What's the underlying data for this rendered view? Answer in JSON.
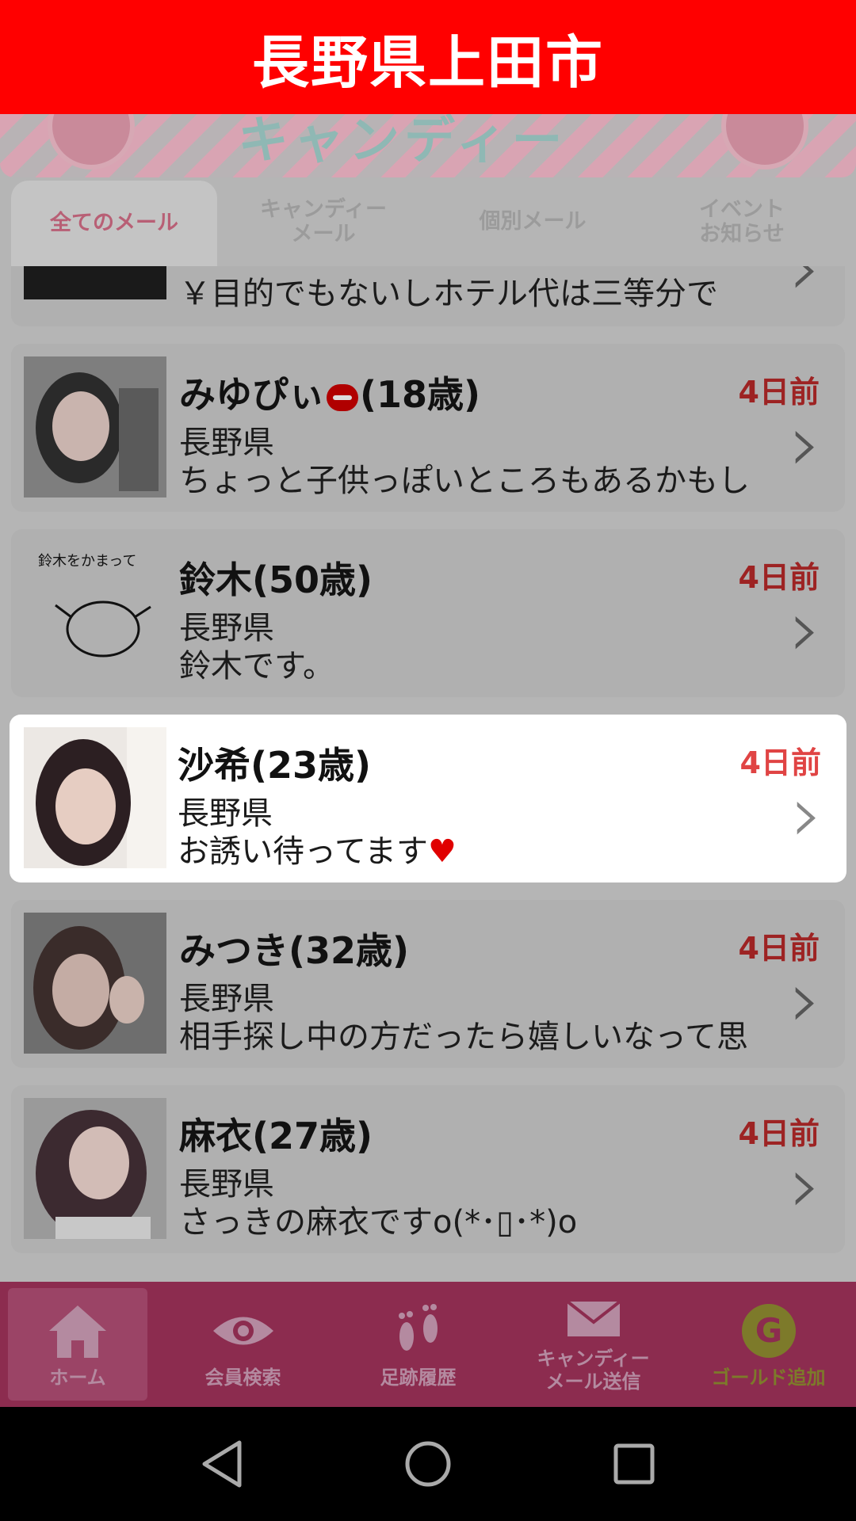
{
  "banner": {
    "title": "長野県上田市"
  },
  "header": {
    "logo_text": "キャンディー"
  },
  "tabs": [
    {
      "label": "全てのメール",
      "active": true
    },
    {
      "label": "キャンディー\nメール",
      "active": false
    },
    {
      "label": "個別メール",
      "active": false
    },
    {
      "label": "イベント\nお知らせ",
      "active": false
    }
  ],
  "messages": {
    "partial": {
      "msg": "￥目的でもないしホテル代は三等分で"
    },
    "items": [
      {
        "name": "みゆぴぃ",
        "age": "(18歳)",
        "time": "4日前",
        "pref": "長野県",
        "msg": "ちょっと子供っぽいところもあるかもし"
      },
      {
        "name": "鈴木(50歳)",
        "time": "4日前",
        "pref": "長野県",
        "msg": "鈴木です。",
        "thumb_text": "鈴木をかまって"
      },
      {
        "name": "沙希(23歳)",
        "time": "4日前",
        "pref": "長野県",
        "msg": "お誘い待ってます",
        "heart": "♥"
      },
      {
        "name": "みつき(32歳)",
        "time": "4日前",
        "pref": "長野県",
        "msg": "相手探し中の方だったら嬉しいなって思"
      },
      {
        "name": "麻衣(27歳)",
        "time": "4日前",
        "pref": "長野県",
        "msg": "さっきの麻衣ですo(*･▯･*)o"
      }
    ]
  },
  "bottom_nav": [
    {
      "label": "ホーム",
      "icon": "home-icon"
    },
    {
      "label": "会員検索",
      "icon": "eye-icon"
    },
    {
      "label": "足跡履歴",
      "icon": "footprints-icon"
    },
    {
      "label": "キャンディー\nメール送信",
      "icon": "mail-icon"
    },
    {
      "label": "ゴールド追加",
      "icon": "gold-g-icon"
    }
  ],
  "colors": {
    "banner": "#ff0000",
    "time_highlight": "#e04444",
    "nav_bg": "#8c2c4f"
  }
}
